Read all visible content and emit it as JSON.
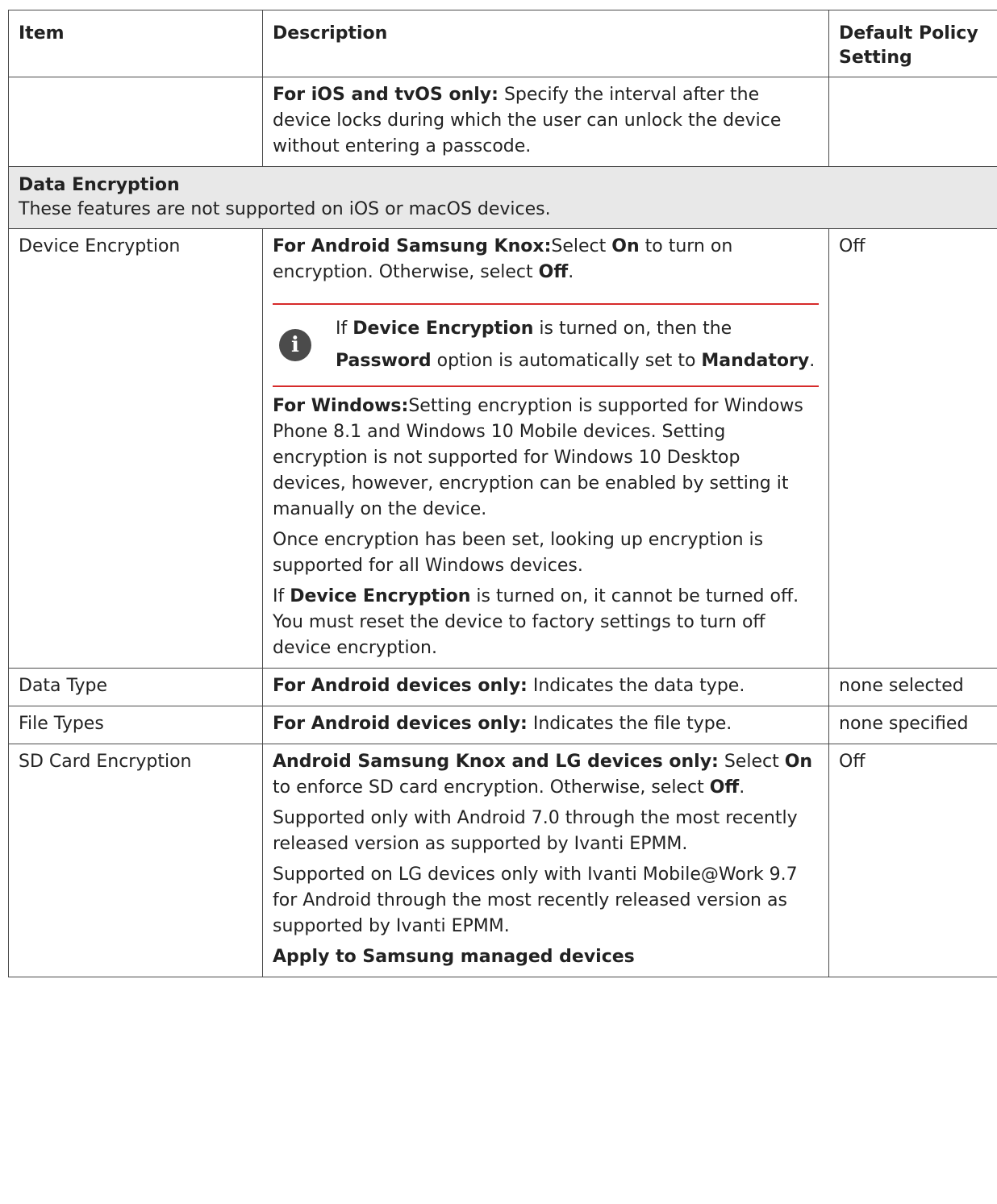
{
  "table": {
    "headers": {
      "item": "Item",
      "description": "Description",
      "default": "Default Policy Setting"
    },
    "continuation_row": {
      "desc_bold": "For iOS and tvOS only:",
      "desc_text": " Specify the interval after the device locks during which the user can unlock the device without entering a passcode."
    },
    "section": {
      "title": "Data Encryption",
      "subtitle": "These features are not supported on iOS or macOS devices."
    },
    "device_encryption": {
      "item": "Device Encryption",
      "default": "Off",
      "android_bold": "For Android Samsung Knox:",
      "android_t1": "Select ",
      "android_on": "On",
      "android_t2": " to turn on encryption. Otherwise, select ",
      "android_off": "Off",
      "android_t3": ".",
      "note_t1": "If ",
      "note_b1": "Device Encryption",
      "note_t2": " is turned on, then the ",
      "note_b2": "Password",
      "note_t3": " option is automatically set to ",
      "note_b3": "Mandatory",
      "note_t4": ".",
      "windows_bold": "For Windows:",
      "windows_text": "Setting encryption is supported for Windows Phone 8.1 and Windows 10 Mobile devices. Setting encryption is not supported for Windows 10 Desktop devices, however, encryption can be enabled by setting it manually on the device.",
      "lookup_text": "Once encryption has been set, looking up encryption is supported for all Windows devices.",
      "off_t1": "If ",
      "off_b1": "Device Encryption",
      "off_t2": " is turned on, it cannot be turned off. You must reset the device to factory settings to turn off device encryption."
    },
    "data_type": {
      "item": "Data Type",
      "desc_bold": "For Android devices only:",
      "desc_text": " Indicates the data type.",
      "default": "none selected"
    },
    "file_types": {
      "item": "File Types",
      "desc_bold": "For Android devices only:",
      "desc_text": " Indicates the file type.",
      "default": "none specified"
    },
    "sd_card": {
      "item": "SD Card Encryption",
      "default": "Off",
      "desc_bold": "Android Samsung Knox and LG devices only:",
      "desc_t1": " Select ",
      "desc_on": "On",
      "desc_t2": " to enforce SD card encryption. Otherwise, select ",
      "desc_off": "Off",
      "desc_t3": ".",
      "supported_android": "Supported only with Android 7.0 through the most recently released version as supported by Ivanti EPMM.",
      "supported_lg": "Supported on LG devices only with Ivanti Mobile@Work 9.7 for Android through the most recently released version as supported by Ivanti EPMM.",
      "apply_bold": "Apply to Samsung managed devices"
    }
  }
}
